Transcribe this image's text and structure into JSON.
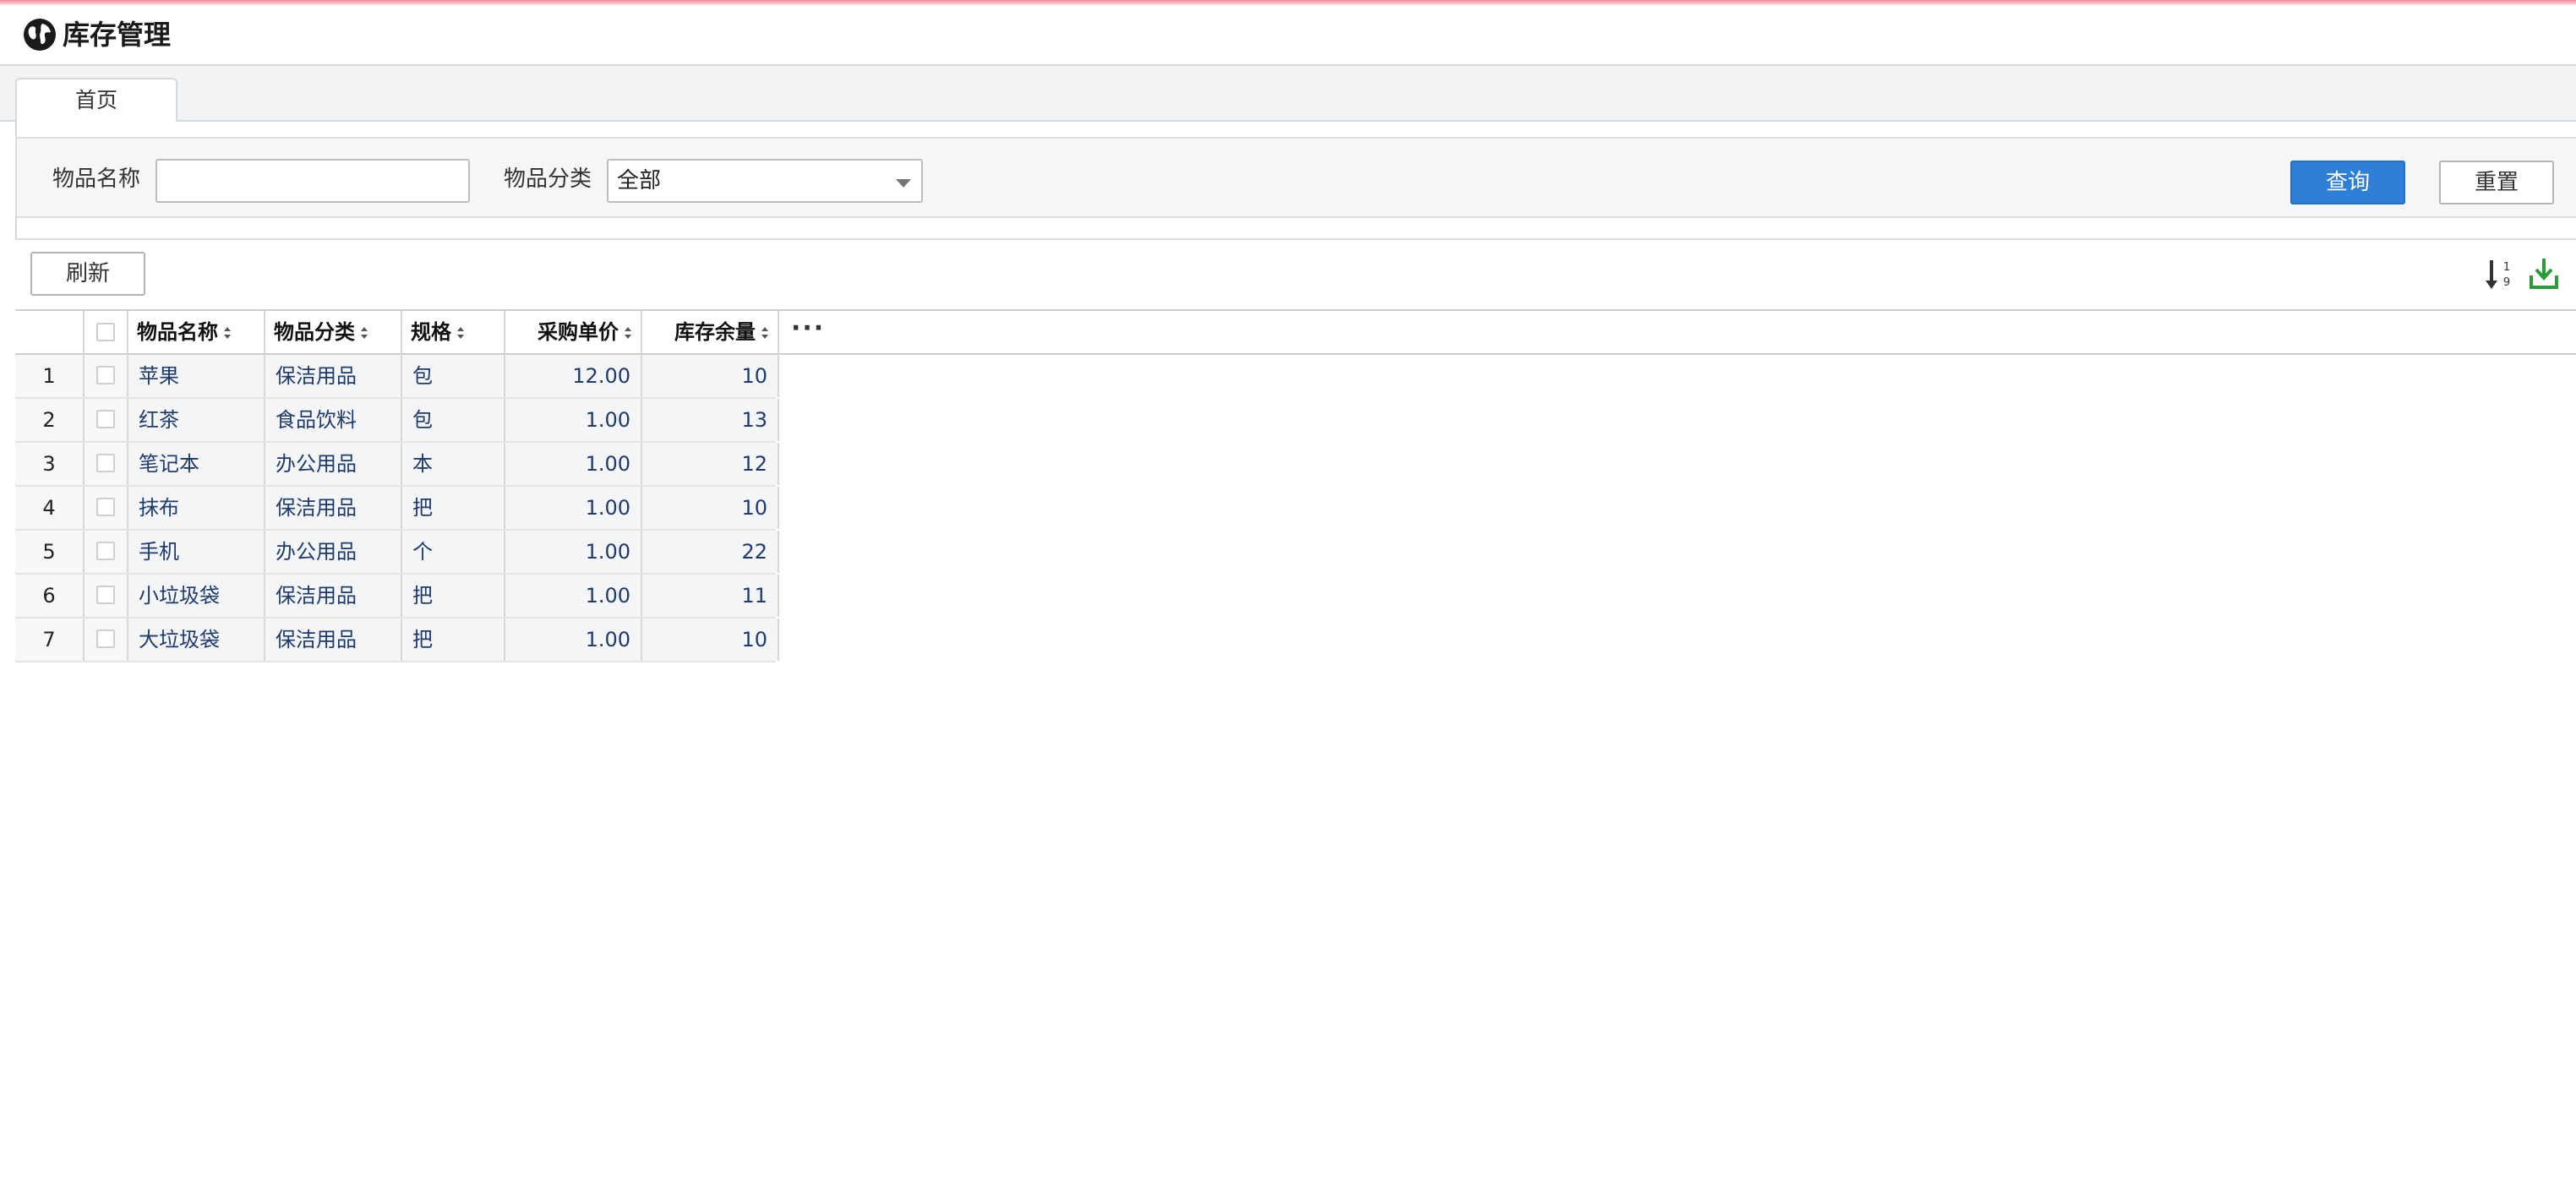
{
  "app": {
    "title": "库存管理"
  },
  "tabs": [
    {
      "label": "首页"
    }
  ],
  "search": {
    "name_label": "物品名称",
    "name_value": "",
    "category_label": "物品分类",
    "category_value": "全部",
    "query_button": "查询",
    "reset_button": "重置"
  },
  "toolbar": {
    "refresh_button": "刷新",
    "sort_icon": "sort-1-9-icon",
    "export_icon": "download-icon"
  },
  "grid": {
    "columns": [
      "物品名称",
      "物品分类",
      "规格",
      "采购单价",
      "库存余量"
    ],
    "more": "···",
    "rows": [
      {
        "index": "1",
        "name": "苹果",
        "category": "保洁用品",
        "spec": "包",
        "price": "12.00",
        "stock": "10"
      },
      {
        "index": "2",
        "name": "红茶",
        "category": "食品饮料",
        "spec": "包",
        "price": "1.00",
        "stock": "13"
      },
      {
        "index": "3",
        "name": "笔记本",
        "category": "办公用品",
        "spec": "本",
        "price": "1.00",
        "stock": "12"
      },
      {
        "index": "4",
        "name": "抹布",
        "category": "保洁用品",
        "spec": "把",
        "price": "1.00",
        "stock": "10"
      },
      {
        "index": "5",
        "name": "手机",
        "category": "办公用品",
        "spec": "个",
        "price": "1.00",
        "stock": "22"
      },
      {
        "index": "6",
        "name": "小垃圾袋",
        "category": "保洁用品",
        "spec": "把",
        "price": "1.00",
        "stock": "11"
      },
      {
        "index": "7",
        "name": "大垃圾袋",
        "category": "保洁用品",
        "spec": "把",
        "price": "1.00",
        "stock": "10"
      }
    ]
  },
  "colors": {
    "primary": "#2d7fd8",
    "cell_text": "#1e3a6e",
    "export_icon": "#2f9a3a"
  }
}
